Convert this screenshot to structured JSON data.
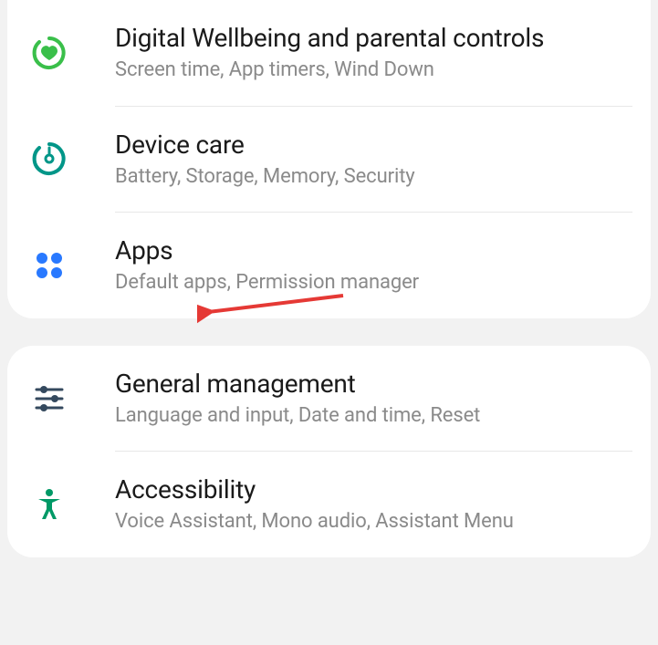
{
  "colors": {
    "wellbeing": "#3ABF4A",
    "devicecare": "#009688",
    "apps": "#2979FF",
    "sliders": "#34495e",
    "accessibility": "#009966",
    "arrow": "#E53935"
  },
  "groups": [
    {
      "items": [
        {
          "id": "digital-wellbeing",
          "title": "Digital Wellbeing and parental controls",
          "subtitle": "Screen time, App timers, Wind Down",
          "icon": "wellbeing-icon"
        },
        {
          "id": "device-care",
          "title": "Device care",
          "subtitle": "Battery, Storage, Memory, Security",
          "icon": "device-care-icon"
        },
        {
          "id": "apps",
          "title": "Apps",
          "subtitle": "Default apps, Permission manager",
          "icon": "apps-icon"
        }
      ]
    },
    {
      "items": [
        {
          "id": "general-management",
          "title": "General management",
          "subtitle": "Language and input, Date and time, Reset",
          "icon": "sliders-icon"
        },
        {
          "id": "accessibility",
          "title": "Accessibility",
          "subtitle": "Voice Assistant, Mono audio, Assistant Menu",
          "icon": "accessibility-icon"
        }
      ]
    }
  ]
}
